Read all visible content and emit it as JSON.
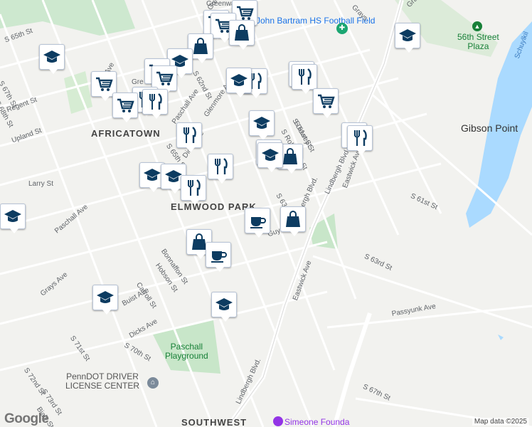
{
  "map": {
    "area_labels": [
      "AFRICATOWN",
      "ELMWOOD PARK",
      "SOUTHWEST"
    ],
    "place_labels": {
      "bartram": "John Bartram HS Football Field",
      "plaza_line1": "56th Street",
      "plaza_line2": "Plaza",
      "gibson": "Gibson Point",
      "paschall_line1": "Paschall",
      "paschall_line2": "Playground",
      "penndot_line1": "PennDOT DRIVER",
      "penndot_line2": "LICENSE CENTER",
      "simeone": "Simeone Founda",
      "schuylkill": "Schuylkil"
    },
    "street_labels": [
      "S 65th St",
      "S 67th St",
      "S 68th St",
      "Regent St",
      "Upland St",
      "Larry St",
      "Paschall Ave",
      "Grays Ave",
      "S 71st St",
      "S 72nd St",
      "S 73rd St",
      "Bialy St",
      "Buist Ave",
      "Carroll St",
      "Hobson St",
      "Dicks Ave",
      "S 70th St",
      "Bonnaffon St",
      "S 66th St",
      "S 65th St",
      "Saybrook Ave",
      "Paschall Ave",
      "Glenmore Ave",
      "S 62nd St",
      "S 61st St",
      "S Dewey St",
      "S Robinson St",
      "S 63rd St",
      "Lindbergh Blvd.",
      "Lindbergh Blvd.",
      "Lindbergh Blvd.",
      "Eastwick Ave",
      "Eastwick Ave",
      "S 61st St",
      "S 63rd St",
      "Passyunk Ave",
      "S 67th St",
      "Grays",
      "Guyer Ave",
      "Buist Ave",
      "Dicks Ave",
      "Greenway Ave",
      "Gre",
      "Grays Ave",
      "Greenway"
    ],
    "road_shields": [
      "⊕"
    ],
    "pins": [
      {
        "type": "shopping-cart"
      },
      {
        "type": "shopping-cart"
      },
      {
        "type": "shopping-cart"
      },
      {
        "type": "shopping-bag"
      },
      {
        "type": "shopping-bag"
      },
      {
        "type": "school"
      },
      {
        "type": "school"
      },
      {
        "type": "school"
      },
      {
        "type": "shopping-cart"
      },
      {
        "type": "shopping-cart"
      },
      {
        "type": "restaurant"
      },
      {
        "type": "shopping-cart"
      },
      {
        "type": "restaurant"
      },
      {
        "type": "restaurant"
      },
      {
        "type": "school"
      },
      {
        "type": "restaurant"
      },
      {
        "type": "shopping-cart"
      },
      {
        "type": "restaurant"
      },
      {
        "type": "shopping-cart"
      },
      {
        "type": "school"
      },
      {
        "type": "shopping-bag"
      },
      {
        "type": "restaurant"
      },
      {
        "type": "restaurant"
      },
      {
        "type": "school"
      },
      {
        "type": "school"
      },
      {
        "type": "school"
      },
      {
        "type": "restaurant"
      },
      {
        "type": "restaurant"
      },
      {
        "type": "school"
      },
      {
        "type": "cafe"
      },
      {
        "type": "shopping-bag"
      },
      {
        "type": "restaurant"
      },
      {
        "type": "shopping-bag"
      },
      {
        "type": "cafe"
      },
      {
        "type": "school"
      },
      {
        "type": "school"
      },
      {
        "type": "school"
      }
    ],
    "colors": {
      "land": "#f2f2ef",
      "water": "#aadaff",
      "park": "#c8e6c9",
      "road": "#ffffff",
      "pin_icon": "#0d3c61"
    }
  },
  "footer": {
    "logo": "Google",
    "attribution": "Map data ©2025"
  }
}
